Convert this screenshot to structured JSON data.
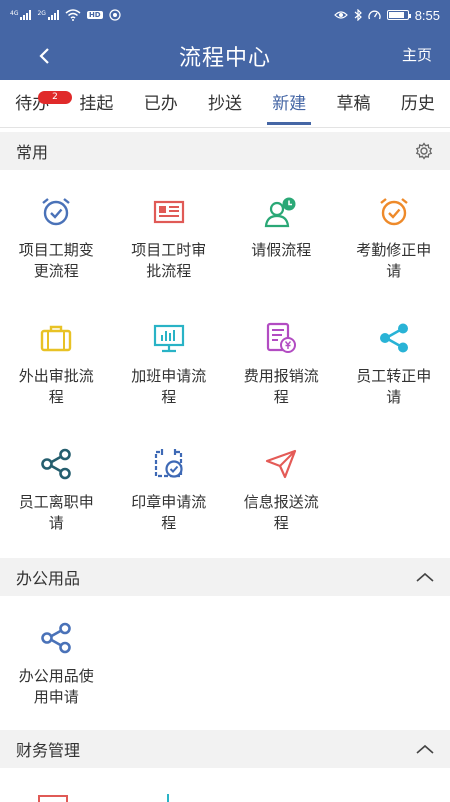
{
  "status_bar": {
    "sim1_tag": "4G",
    "sim2_tag": "2G",
    "vpn_tag": "HD",
    "time": "8:55"
  },
  "nav": {
    "title": "流程中心",
    "home_label": "主页"
  },
  "tabs": [
    {
      "label": "待办",
      "badge": "2"
    },
    {
      "label": "挂起"
    },
    {
      "label": "已办"
    },
    {
      "label": "抄送"
    },
    {
      "label": "新建",
      "active": true
    },
    {
      "label": "草稿"
    },
    {
      "label": "历史"
    }
  ],
  "sections": {
    "common": {
      "title": "常用",
      "items": [
        {
          "label": "项目工期变更流程",
          "icon": "alarm-clock-icon",
          "color": "#4a72b8"
        },
        {
          "label": "项目工时审批流程",
          "icon": "newspaper-icon",
          "color": "#e05a56"
        },
        {
          "label": "请假流程",
          "icon": "user-clock-icon",
          "color": "#2aa876"
        },
        {
          "label": "考勤修正申请",
          "icon": "alarm-clock-icon",
          "color": "#ee8a2a"
        },
        {
          "label": "外出审批流程",
          "icon": "briefcase-icon",
          "color": "#e8c225"
        },
        {
          "label": "加班申请流程",
          "icon": "presentation-chart-icon",
          "color": "#29b3c6"
        },
        {
          "label": "费用报销流程",
          "icon": "expense-document-icon",
          "color": "#b24cc2"
        },
        {
          "label": "员工转正申请",
          "icon": "share-icon",
          "color": "#29b3d6"
        },
        {
          "label": "员工离职申请",
          "icon": "share-icon",
          "color": "#255e6e"
        },
        {
          "label": "印章申请流程",
          "icon": "calendar-check-icon",
          "color": "#3e69b5"
        },
        {
          "label": "信息报送流程",
          "icon": "paper-plane-icon",
          "color": "#e45b57"
        }
      ]
    },
    "office_supplies": {
      "title": "办公用品",
      "items": [
        {
          "label": "办公用品使用申请",
          "icon": "share-icon",
          "color": "#4a72b8"
        }
      ]
    },
    "finance": {
      "title": "财务管理"
    }
  }
}
